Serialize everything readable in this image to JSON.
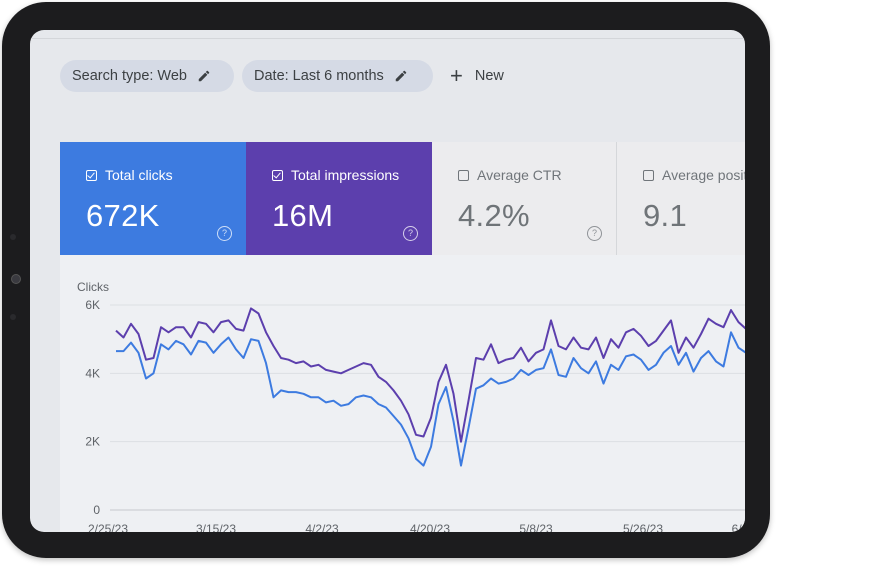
{
  "filters": {
    "search_type": "Search type: Web",
    "date": "Date: Last 6 months",
    "new_label": "New"
  },
  "metrics": [
    {
      "label": "Total clicks",
      "value": "672K",
      "checked": true,
      "color": "#3d7be0"
    },
    {
      "label": "Total impressions",
      "value": "16M",
      "checked": true,
      "color": "#5c3fad"
    },
    {
      "label": "Average CTR",
      "value": "4.2%",
      "checked": false
    },
    {
      "label": "Average positi",
      "value": "9.1",
      "checked": false
    }
  ],
  "chart_data": {
    "type": "line",
    "ylabel": "Clicks",
    "ylim": [
      0,
      6000
    ],
    "y_ticks": [
      "6K",
      "4K",
      "2K",
      "0"
    ],
    "x_ticks": [
      "2/25/23",
      "3/15/23",
      "4/2/23",
      "4/20/23",
      "5/8/23",
      "5/26/23",
      "6/1"
    ],
    "series": [
      {
        "color": "#5c3fad",
        "values": [
          5250,
          5050,
          5450,
          5150,
          4400,
          4450,
          5350,
          5200,
          5350,
          5350,
          5050,
          5500,
          5450,
          5200,
          5500,
          5550,
          5300,
          5250,
          5900,
          5750,
          5200,
          4800,
          4450,
          4400,
          4300,
          4350,
          4200,
          4250,
          4100,
          4050,
          4000,
          4100,
          4200,
          4300,
          4250,
          3900,
          3750,
          3500,
          3200,
          2800,
          2200,
          2150,
          2700,
          3750,
          4250,
          3400,
          2000,
          3200,
          4450,
          4400,
          4850,
          4300,
          4400,
          4450,
          4750,
          4350,
          4600,
          4700,
          5550,
          4800,
          4700,
          5050,
          4750,
          4700,
          5050,
          4450,
          5000,
          4750,
          5200,
          5300,
          5100,
          4800,
          4950,
          5250,
          5550,
          4600,
          5050,
          4750,
          5150,
          5600,
          5450,
          5350,
          5850,
          5500,
          5300
        ]
      },
      {
        "color": "#3d7be0",
        "values": [
          4650,
          4650,
          4900,
          4600,
          3850,
          4000,
          4850,
          4700,
          4950,
          4850,
          4550,
          4950,
          4900,
          4600,
          4850,
          5050,
          4700,
          4450,
          5000,
          4950,
          4300,
          3300,
          3500,
          3450,
          3450,
          3400,
          3300,
          3300,
          3150,
          3200,
          3050,
          3100,
          3300,
          3350,
          3300,
          3100,
          3000,
          2750,
          2500,
          2100,
          1500,
          1300,
          1850,
          3100,
          3600,
          2600,
          1300,
          2400,
          3550,
          3650,
          3850,
          3700,
          3750,
          3850,
          4100,
          3950,
          4100,
          4150,
          4700,
          3950,
          3900,
          4450,
          4150,
          4000,
          4350,
          3700,
          4250,
          4100,
          4500,
          4550,
          4400,
          4100,
          4250,
          4600,
          4800,
          4250,
          4600,
          4050,
          4450,
          4650,
          4350,
          4200,
          5200,
          4750,
          4600
        ]
      }
    ],
    "grid": true
  }
}
